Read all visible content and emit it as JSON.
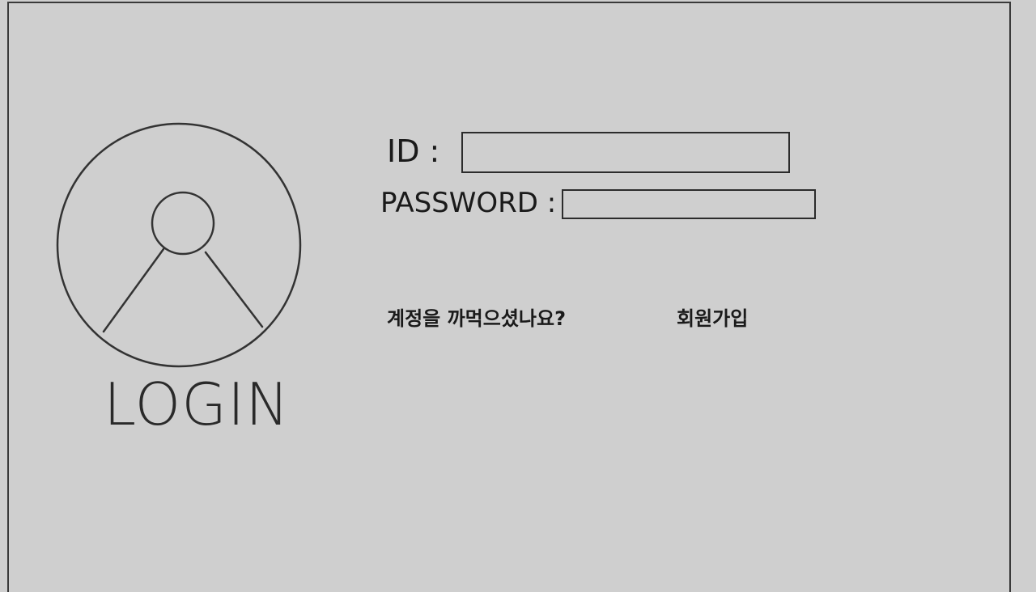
{
  "login": {
    "caption": "LOGIN",
    "id_label": "ID :",
    "password_label": "PASSWORD :",
    "id_value": "",
    "password_value": "",
    "forgot_link": "계정을 까먹으셨나요?",
    "signup_link": "회원가입"
  },
  "icons": {
    "avatar": "user-avatar-icon"
  },
  "colors": {
    "background": "#cfcfcf",
    "ink": "#2a2a2a"
  }
}
